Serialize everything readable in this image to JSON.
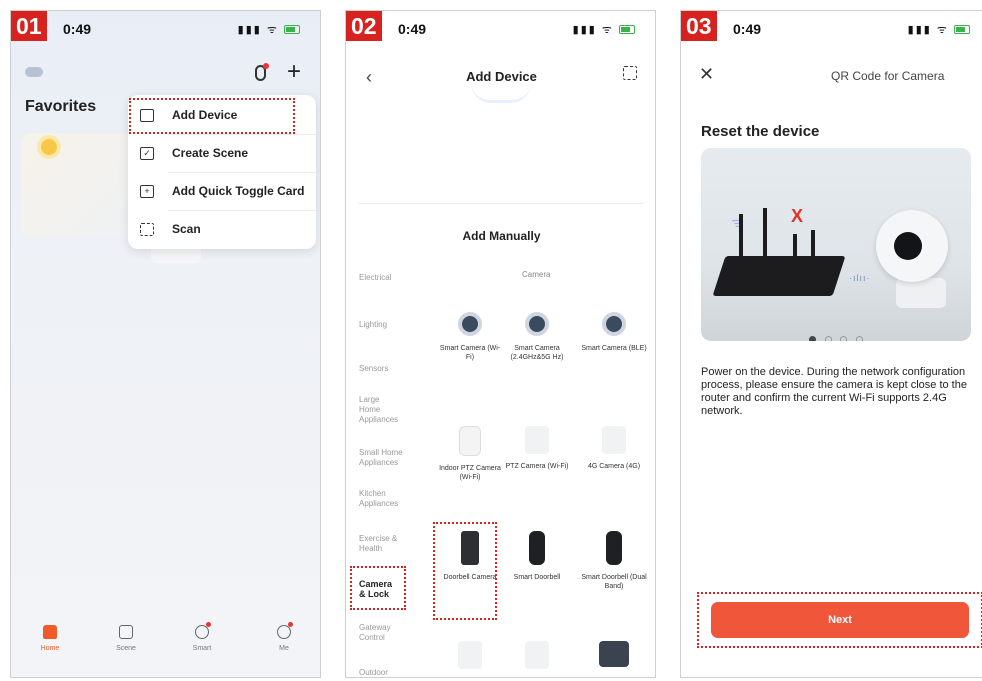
{
  "colors": {
    "badge": "#d7231f",
    "accent": "#f05a2a",
    "highlight": "#d7231f",
    "next_button": "#f0563a"
  },
  "screens": [
    {
      "step": "01",
      "status_time": "0:49",
      "favorites_label": "Favorites",
      "menu": [
        {
          "label": "Add Device",
          "icon": "add-device-icon"
        },
        {
          "label": "Create Scene",
          "icon": "create-scene-icon"
        },
        {
          "label": "Add Quick Toggle Card",
          "icon": "add-card-icon"
        },
        {
          "label": "Scan",
          "icon": "scan-icon"
        }
      ],
      "tabs": [
        {
          "label": "Home",
          "icon": "home-icon",
          "active": true
        },
        {
          "label": "Scene",
          "icon": "scene-icon"
        },
        {
          "label": "Smart",
          "icon": "smart-icon"
        },
        {
          "label": "Me",
          "icon": "me-icon"
        }
      ]
    },
    {
      "step": "02",
      "status_time": "0:49",
      "title": "Add Device",
      "section_heading": "Add Manually",
      "subsection": "Camera",
      "categories": [
        "Electrical",
        "Lighting",
        "Sensors",
        "Large Home Appliances",
        "Small Home Appliances",
        "Kitchen Appliances",
        "Exercise & Health",
        "Camera & Lock",
        "Gateway Control",
        "Outdoor Travel"
      ],
      "active_category": "Camera & Lock",
      "devices": [
        "Smart Camera (Wi-Fi)",
        "Smart Camera (2.4GHz&5G Hz)",
        "Smart Camera (BLE)",
        "Indoor PTZ Camera (Wi-Fi)",
        "PTZ Camera (Wi-Fi)",
        "4G Camera (4G)",
        "Doorbell Camera",
        "Smart Doorbell",
        "Smart Doorbell (Dual Band)"
      ]
    },
    {
      "step": "03",
      "status_time": "0:49",
      "title": "QR Code for Camera",
      "heading": "Reset the device",
      "pager": [
        "1",
        "2",
        "3",
        "4"
      ],
      "current_page": 1,
      "instructions": "Power on the device. During the network configuration process, please ensure the camera is kept close to the router and confirm the current Wi-Fi supports 2.4G network.",
      "next_label": "Next"
    }
  ]
}
